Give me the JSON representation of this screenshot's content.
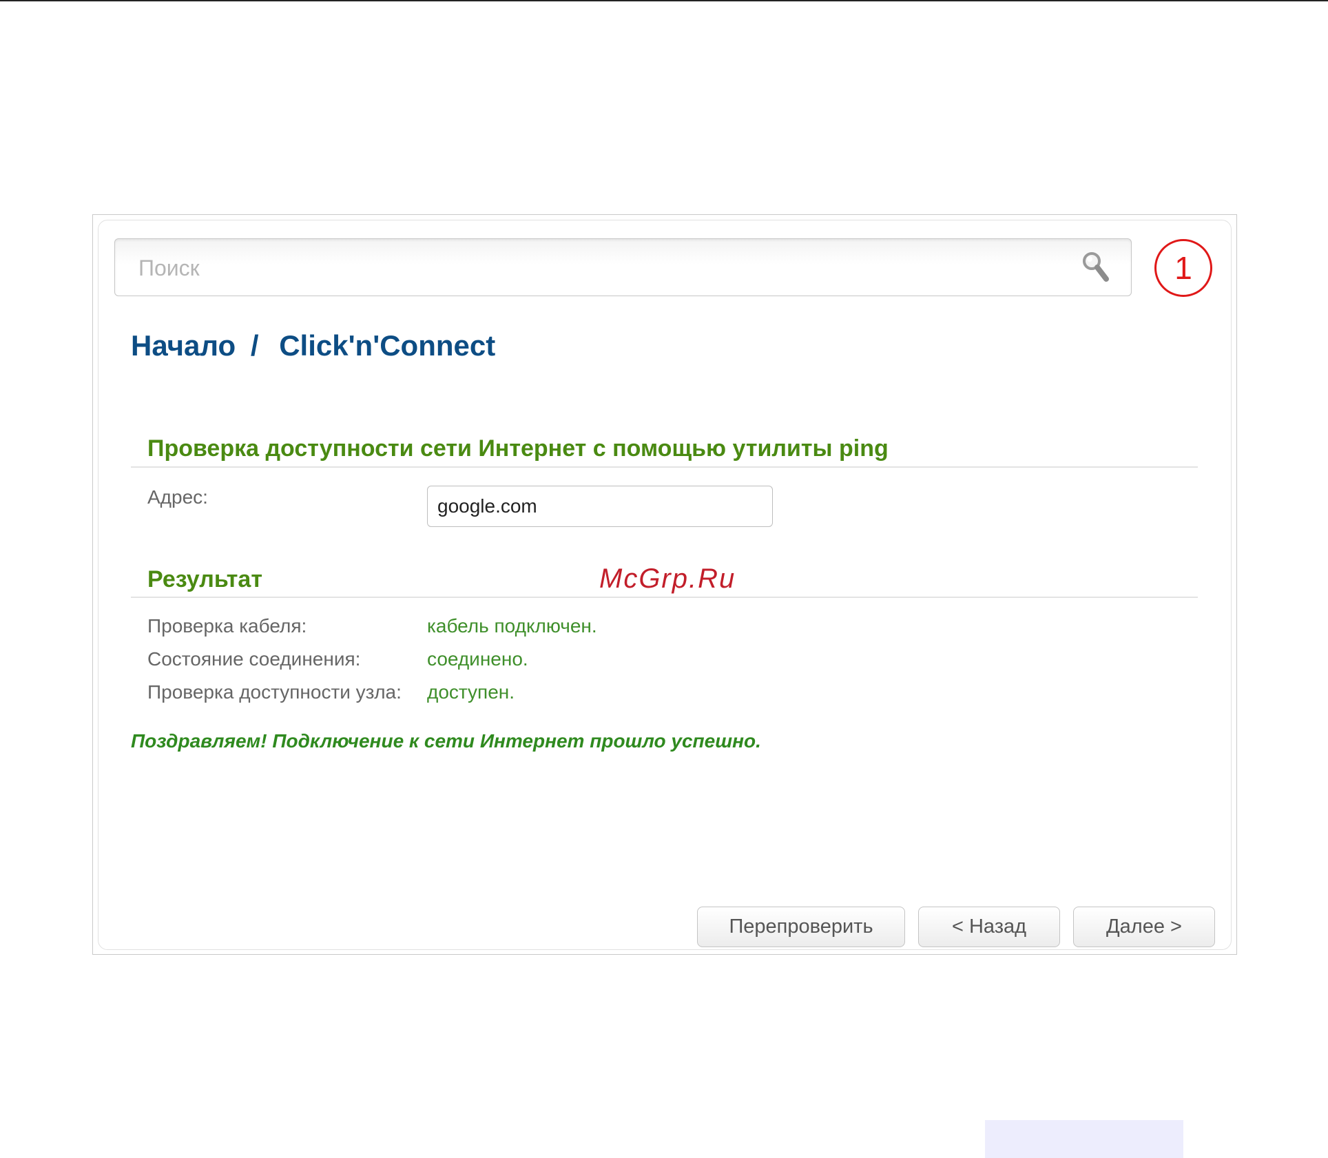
{
  "search": {
    "placeholder": "Поиск"
  },
  "notifications": {
    "count": "1"
  },
  "breadcrumb": {
    "home": "Начало",
    "separator": "/",
    "current": "Click'n'Connect"
  },
  "ping_section": {
    "title": "Проверка доступности сети Интернет с помощью утилиты ping",
    "address_label": "Адрес:",
    "address_value": "google.com"
  },
  "watermark": "McGrp.Ru",
  "result_section": {
    "title": "Результат",
    "rows": [
      {
        "label": "Проверка кабеля:",
        "value": "кабель подключен."
      },
      {
        "label": "Состояние соединения:",
        "value": "соединено."
      },
      {
        "label": "Проверка доступности узла:",
        "value": "доступен."
      }
    ]
  },
  "success_message": "Поздравляем! Подключение к сети Интернет прошло успешно.",
  "buttons": {
    "recheck": "Перепроверить",
    "back": "< Назад",
    "next": "Далее >"
  },
  "colors": {
    "heading_blue": "#0d4d84",
    "section_green": "#4a8a12",
    "value_green": "#3f8f2b",
    "badge_red": "#e01818",
    "watermark_red": "#c21e2a"
  }
}
